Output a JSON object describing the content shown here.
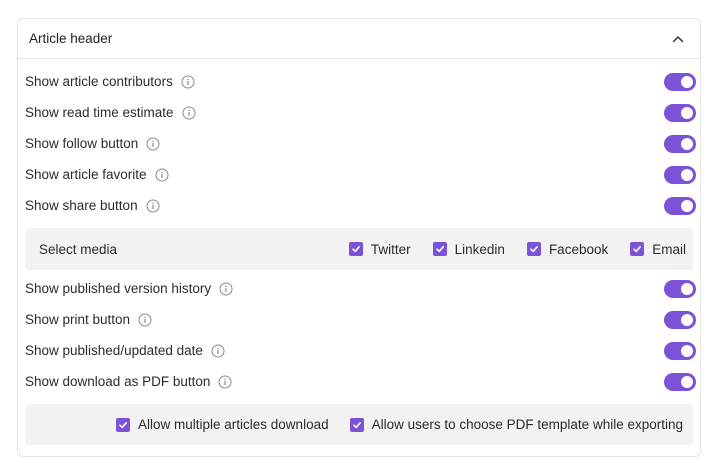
{
  "header": {
    "title": "Article header"
  },
  "rows_top": [
    {
      "label": "Show article contributors",
      "enabled": true
    },
    {
      "label": "Show read time estimate",
      "enabled": true
    },
    {
      "label": "Show follow button",
      "enabled": true
    },
    {
      "label": "Show article favorite",
      "enabled": true
    },
    {
      "label": "Show share button",
      "enabled": true
    }
  ],
  "media": {
    "label": "Select media",
    "options": [
      {
        "label": "Twitter",
        "checked": true
      },
      {
        "label": "Linkedin",
        "checked": true
      },
      {
        "label": "Facebook",
        "checked": true
      },
      {
        "label": "Email",
        "checked": true
      }
    ]
  },
  "rows_bottom": [
    {
      "label": "Show published version history",
      "enabled": true
    },
    {
      "label": "Show print button",
      "enabled": true
    },
    {
      "label": "Show published/updated date",
      "enabled": true
    },
    {
      "label": "Show download as PDF button",
      "enabled": true
    }
  ],
  "pdf": {
    "options": [
      {
        "label": "Allow multiple articles download",
        "checked": true
      },
      {
        "label": "Allow users to choose PDF template while exporting",
        "checked": true
      }
    ]
  },
  "colors": {
    "accent": "#7c53d6",
    "subpanel_bg": "#f2f2f3",
    "border": "#e4e4e7"
  },
  "icons": {
    "info": "info-icon",
    "collapse": "chevron-up-icon",
    "check": "check-icon"
  }
}
